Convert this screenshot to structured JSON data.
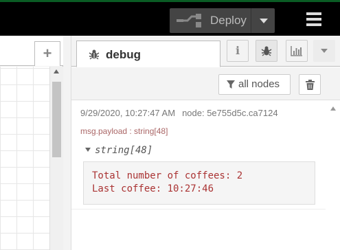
{
  "header": {
    "deploy_label": "Deploy",
    "menu_icon": "hamburger-icon",
    "colors": {
      "background": "#000000",
      "deploy_bg": "#444444"
    }
  },
  "workspace": {
    "add_tab_label": "+"
  },
  "sidebar": {
    "active_tab": {
      "label": "debug",
      "icon": "bug-icon"
    },
    "buttons": [
      {
        "name": "info",
        "label": "i"
      },
      {
        "name": "debug",
        "icon": "bug-icon",
        "selected": true
      },
      {
        "name": "dashboard",
        "icon": "bar-chart-icon"
      },
      {
        "name": "more",
        "icon": "caret-down-icon"
      }
    ],
    "toolbar": {
      "filter_label": "all nodes",
      "clear_icon": "trash-icon"
    },
    "message": {
      "timestamp": "9/29/2020, 10:27:47 AM",
      "node": "node: 5e755d5c.ca7124",
      "topic": "msg.payload : string[48]",
      "type_label": "string[48]",
      "payload": "Total number of coffees: 2\nLast coffee: 10:27:46"
    }
  }
}
